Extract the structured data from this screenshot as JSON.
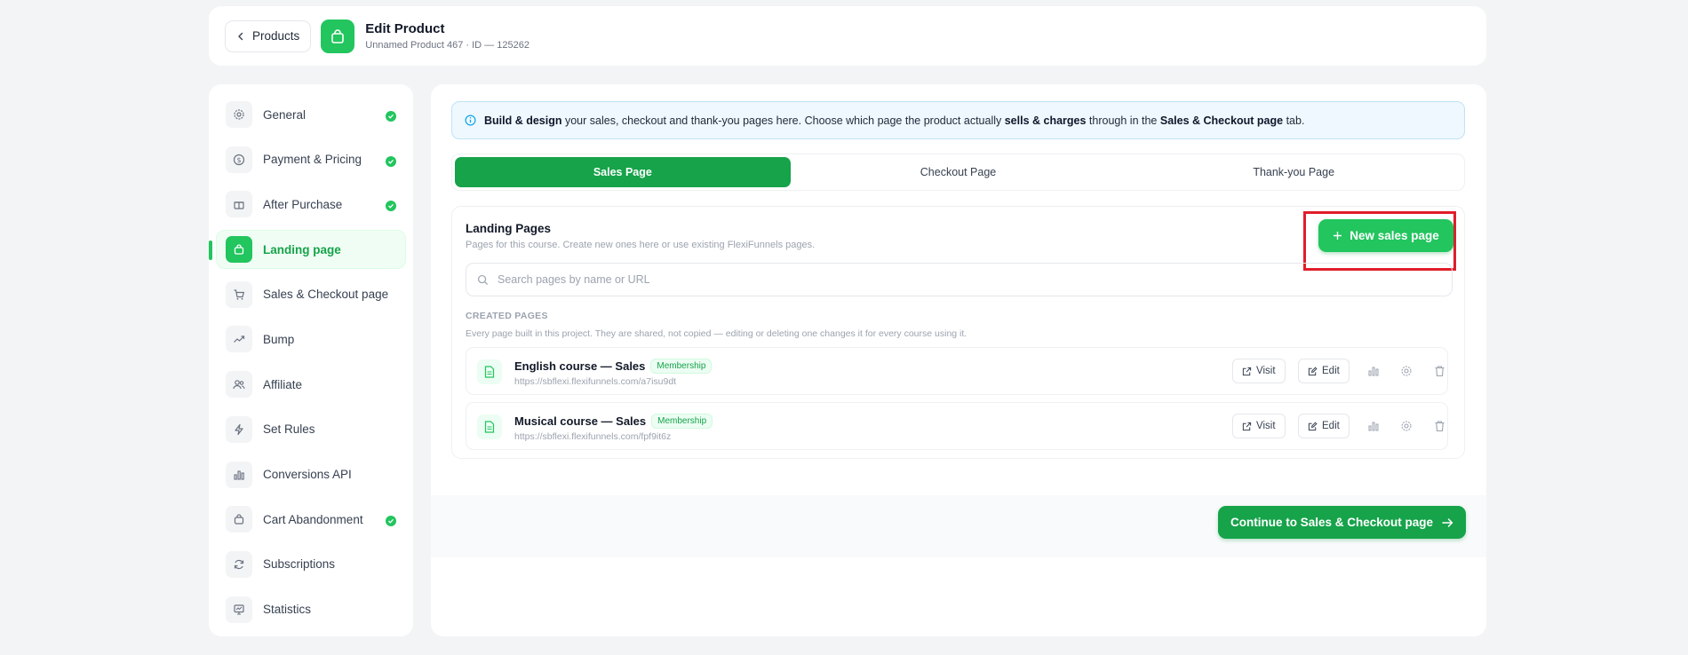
{
  "header": {
    "back_label": "Products",
    "title": "Edit Product",
    "subtitle": "Unnamed Product 467 · ID — 125262"
  },
  "sidebar": {
    "items": [
      {
        "label": "General",
        "icon": "gear-icon",
        "complete": true
      },
      {
        "label": "Payment & Pricing",
        "icon": "dollar-icon",
        "complete": true
      },
      {
        "label": "After Purchase",
        "icon": "gift-icon",
        "complete": true
      },
      {
        "label": "Landing page",
        "icon": "bag-icon",
        "complete": false,
        "active": true
      },
      {
        "label": "Sales & Checkout page",
        "icon": "cart-icon",
        "complete": false
      },
      {
        "label": "Bump",
        "icon": "trend-icon",
        "complete": false
      },
      {
        "label": "Affiliate",
        "icon": "users-icon",
        "complete": false
      },
      {
        "label": "Set Rules",
        "icon": "bolt-icon",
        "complete": false
      },
      {
        "label": "Conversions API",
        "icon": "bar-chart-icon",
        "complete": false
      },
      {
        "label": "Cart Abandonment",
        "icon": "bag-icon",
        "complete": true
      },
      {
        "label": "Subscriptions",
        "icon": "refresh-icon",
        "complete": false
      },
      {
        "label": "Statistics",
        "icon": "presentation-icon",
        "complete": false
      }
    ]
  },
  "info": {
    "bold1": "Build & design",
    "text1": " your sales, checkout and thank-you pages here. Choose which page the product actually ",
    "bold2": "sells & charges",
    "text2": " through in the ",
    "bold3": "Sales & Checkout page",
    "text3": " tab."
  },
  "tabs": [
    "Sales Page",
    "Checkout Page",
    "Thank-you Page"
  ],
  "landing": {
    "title": "Landing Pages",
    "subtitle": "Pages for this course. Create new ones here or use existing FlexiFunnels pages.",
    "new_button": "New sales page",
    "search_placeholder": "Search pages by name or URL",
    "section_label": "CREATED PAGES",
    "section_desc": "Every page built in this project. They are shared, not copied — editing or deleting one changes it for every course using it.",
    "visit_label": "Visit",
    "edit_label": "Edit",
    "pages": [
      {
        "name": "English course — Sales",
        "badge": "Membership",
        "url": "https://sbflexi.flexifunnels.com/a7isu9dt"
      },
      {
        "name": "Musical course — Sales",
        "badge": "Membership",
        "url": "https://sbflexi.flexifunnels.com/fpf9it6z"
      }
    ]
  },
  "footer": {
    "continue_label": "Continue to Sales & Checkout page"
  },
  "colors": {
    "accent": "#22c55e",
    "accent_dark": "#16a34a",
    "highlight": "#e11d2a"
  }
}
